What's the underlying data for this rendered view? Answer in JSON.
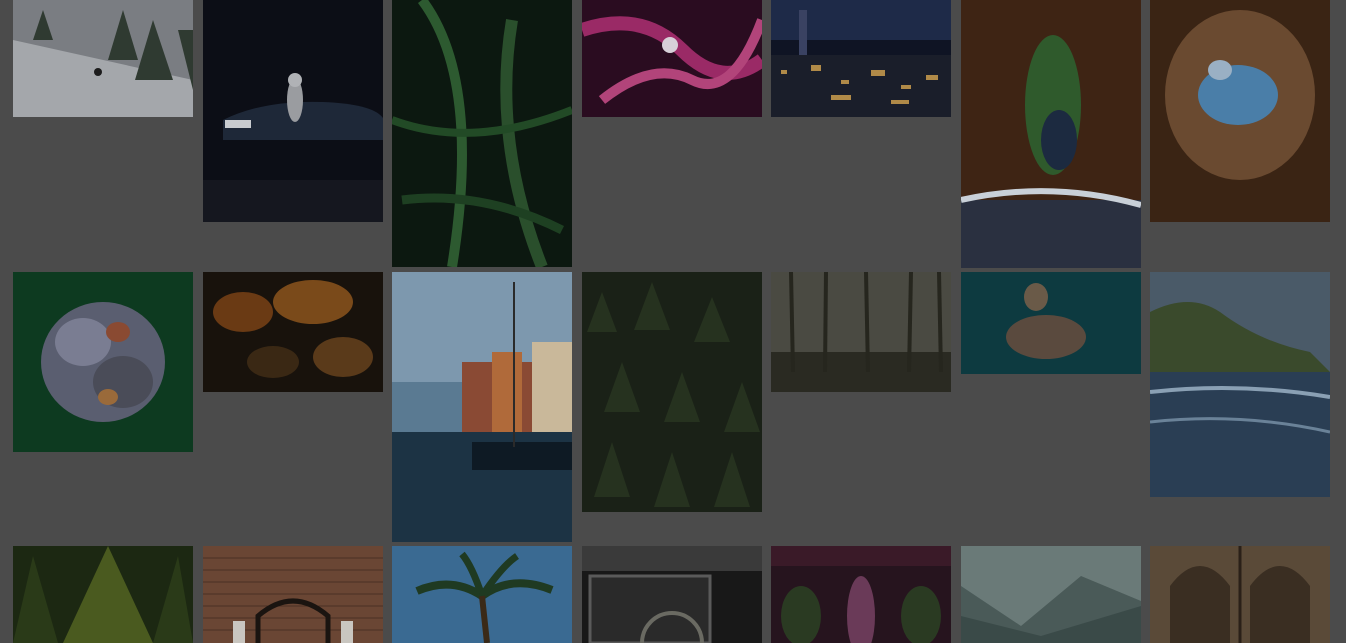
{
  "gallery": {
    "background": "#4b4b4b",
    "dim_overlay": true,
    "photos": [
      {
        "id": "p1",
        "subject": "snowboarder-snowy-forest",
        "colors": [
          "#6c6e72",
          "#9fa3a8",
          "#3d4a40"
        ]
      },
      {
        "id": "p2",
        "subject": "astronaut-classic-car-night",
        "colors": [
          "#0e1019",
          "#1c2230",
          "#2b3a52"
        ]
      },
      {
        "id": "p3",
        "subject": "fern-leaves",
        "colors": [
          "#0f1a12",
          "#1f3a22",
          "#2d5530"
        ]
      },
      {
        "id": "p4",
        "subject": "pink-coral-tendrils",
        "colors": [
          "#3a0f2a",
          "#7b2053",
          "#b2447a"
        ]
      },
      {
        "id": "p5",
        "subject": "city-skyline-night",
        "colors": [
          "#101522",
          "#2a3350",
          "#c79b52"
        ]
      },
      {
        "id": "p6",
        "subject": "aerial-island-coast",
        "colors": [
          "#3f2414",
          "#6b3d22",
          "#2f5a2c"
        ]
      },
      {
        "id": "p7",
        "subject": "aerial-desert-lake",
        "colors": [
          "#3a2516",
          "#6e4a2f",
          "#4b7fa8"
        ]
      },
      {
        "id": "p8",
        "subject": "abstract-sculpture-green",
        "colors": [
          "#0f3a22",
          "#6b6f86",
          "#9a5a3e"
        ]
      },
      {
        "id": "p9",
        "subject": "abstract-orange-texture",
        "colors": [
          "#1c1510",
          "#6b3a14",
          "#9a5a22"
        ]
      },
      {
        "id": "p10",
        "subject": "harbor-sailboats",
        "colors": [
          "#2c4e6b",
          "#8aa4b8",
          "#7b3b2f"
        ]
      },
      {
        "id": "p11",
        "subject": "aerial-pine-forest",
        "colors": [
          "#1b2218",
          "#28331f",
          "#33402a"
        ]
      },
      {
        "id": "p12",
        "subject": "misty-forest",
        "colors": [
          "#2a2a26",
          "#4a4a42",
          "#6b6a60"
        ]
      },
      {
        "id": "p13",
        "subject": "aerial-island-turquoise",
        "colors": [
          "#0b3a40",
          "#16535a",
          "#6b5a4a"
        ]
      },
      {
        "id": "p14",
        "subject": "coastal-cliff-sea",
        "colors": [
          "#2b4a62",
          "#3b5a40",
          "#8a9aa8"
        ]
      },
      {
        "id": "p15",
        "subject": "pine-tree-top",
        "colors": [
          "#1d2a14",
          "#3a4a1f",
          "#5a6a2a"
        ]
      },
      {
        "id": "p16",
        "subject": "brick-wall-chair",
        "colors": [
          "#5a3a2a",
          "#7a5038",
          "#3a2418"
        ]
      },
      {
        "id": "p17",
        "subject": "palm-tree-sky",
        "colors": [
          "#2d5a82",
          "#4b7aa0",
          "#1f3a22"
        ]
      },
      {
        "id": "p18",
        "subject": "vintage-car-interior",
        "colors": [
          "#1a1a1a",
          "#3a3a3a",
          "#6a6a6a"
        ]
      },
      {
        "id": "p19",
        "subject": "lupine-flower",
        "colors": [
          "#2a1a22",
          "#5a3048",
          "#3a4a2a"
        ]
      },
      {
        "id": "p20",
        "subject": "misty-mountains",
        "colors": [
          "#4a5a5a",
          "#5a6a6a",
          "#6a7a78"
        ]
      },
      {
        "id": "p21",
        "subject": "gothic-arches-hall",
        "colors": [
          "#3a2e22",
          "#5a4a3a",
          "#7a6a52"
        ]
      }
    ]
  }
}
